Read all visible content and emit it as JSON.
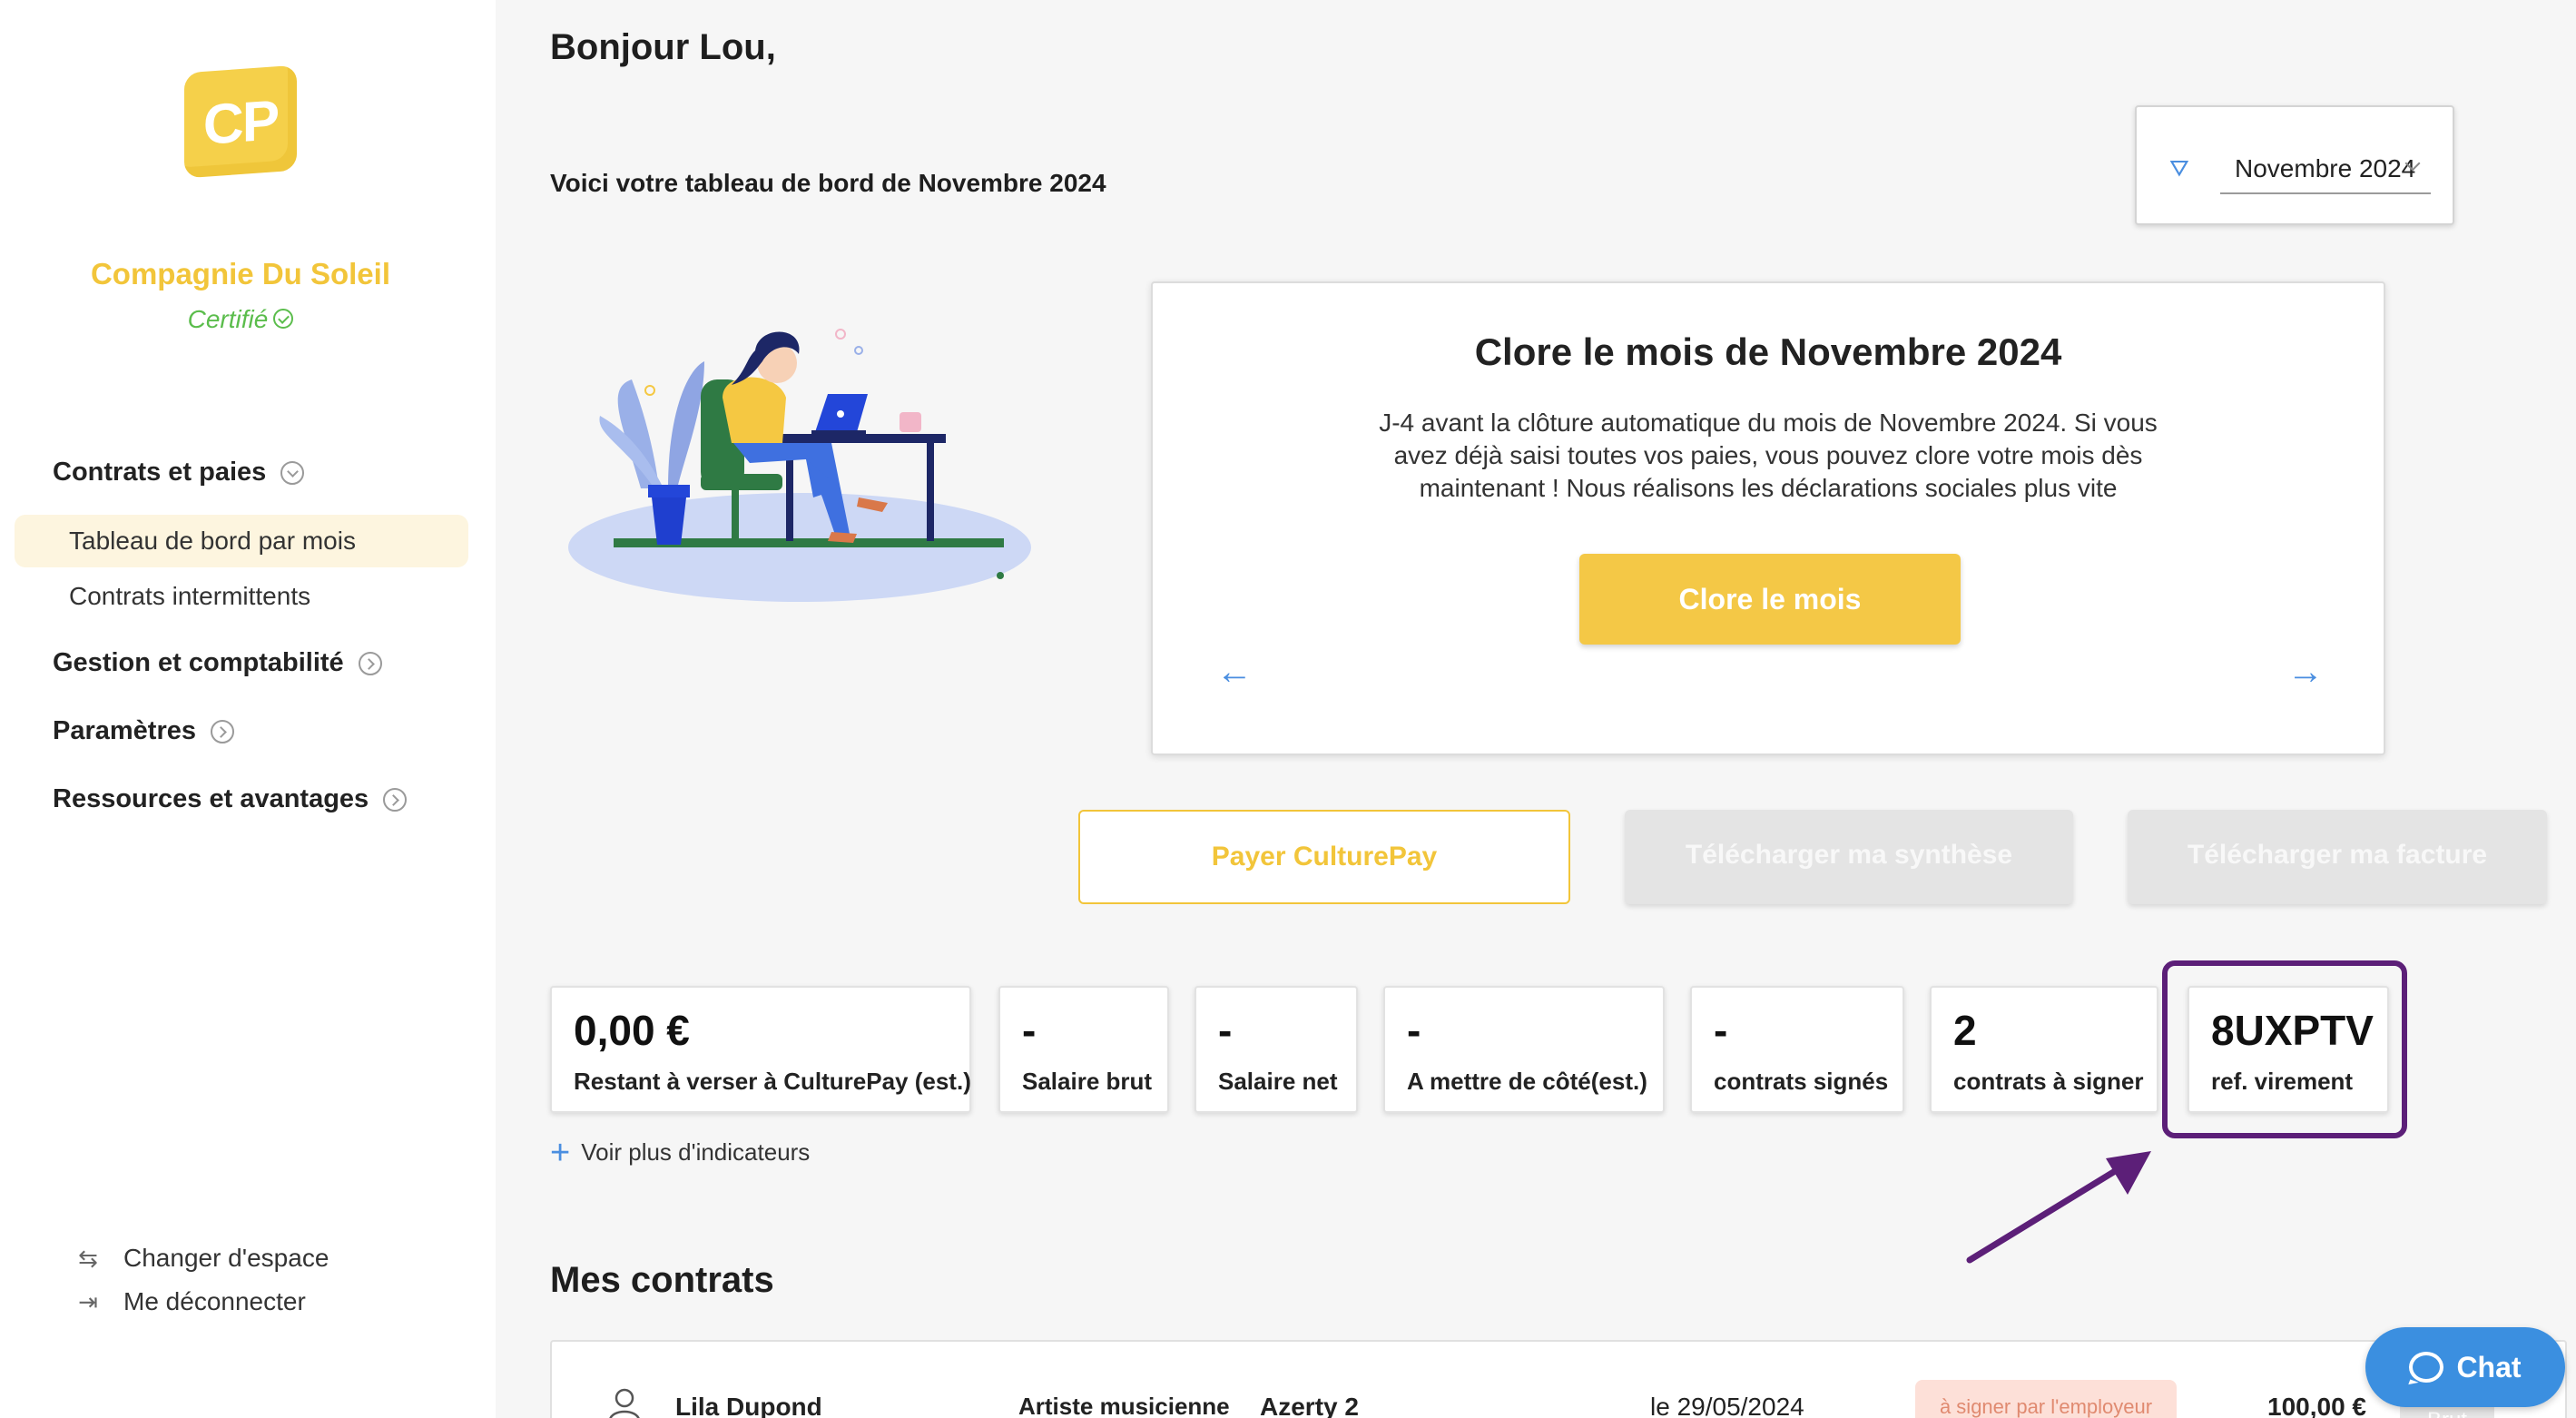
{
  "sidebar": {
    "logo_text": "CP",
    "company_name": "Compagnie Du Soleil",
    "certified_label": "Certifié",
    "nav": {
      "contracts_group": "Contrats et paies",
      "dashboard_item": "Tableau de bord par mois",
      "intermittent_item": "Contrats intermittents",
      "management_group": "Gestion et comptabilité",
      "settings_group": "Paramètres",
      "resources_group": "Ressources et avantages"
    },
    "footer": {
      "switch_space": "Changer d'espace",
      "logout": "Me déconnecter"
    }
  },
  "header": {
    "greeting": "Bonjour Lou,",
    "subtitle": "Voici votre tableau de bord de Novembre 2024",
    "month_filter": {
      "value": "Novembre 2024",
      "icon": "filter-icon"
    }
  },
  "close_card": {
    "title": "Clore le mois de Novembre 2024",
    "text": "J-4 avant la clôture automatique du mois de Novembre 2024. Si vous avez déjà saisi toutes vos paies, vous pouvez clore votre mois dès maintenant ! Nous réalisons les déclarations sociales plus vite",
    "button": "Clore le mois",
    "prev_arrow": "←",
    "next_arrow": "→"
  },
  "actions": {
    "pay": "Payer CulturePay",
    "download_summary": "Télécharger ma synthèse",
    "download_invoice": "Télécharger ma facture"
  },
  "kpis": [
    {
      "value": "0,00 €",
      "label": "Restant à verser à CulturePay (est.)"
    },
    {
      "value": "-",
      "label": "Salaire brut"
    },
    {
      "value": "-",
      "label": "Salaire net"
    },
    {
      "value": "-",
      "label": "A mettre de côté(est.)"
    },
    {
      "value": "-",
      "label": "contrats signés"
    },
    {
      "value": "2",
      "label": "contrats à signer"
    },
    {
      "value": "8UXPTV",
      "label": "ref. virement"
    }
  ],
  "more_indicators": "Voir plus d'indicateurs",
  "contracts": {
    "title": "Mes contrats",
    "rows": [
      {
        "name": "Lila Dupond",
        "role": "Artiste musicienne",
        "project": "Azerty 2",
        "date": "le 29/05/2024",
        "status": "à signer par l'employeur",
        "amount": "100,00 €",
        "tag": "Brut"
      }
    ]
  },
  "chat_label": "Chat",
  "colors": {
    "accent_yellow": "#f4c846",
    "certified_green": "#5bbd4c",
    "link_blue": "#4a8ee0",
    "highlight_purple": "#5c1f78"
  }
}
